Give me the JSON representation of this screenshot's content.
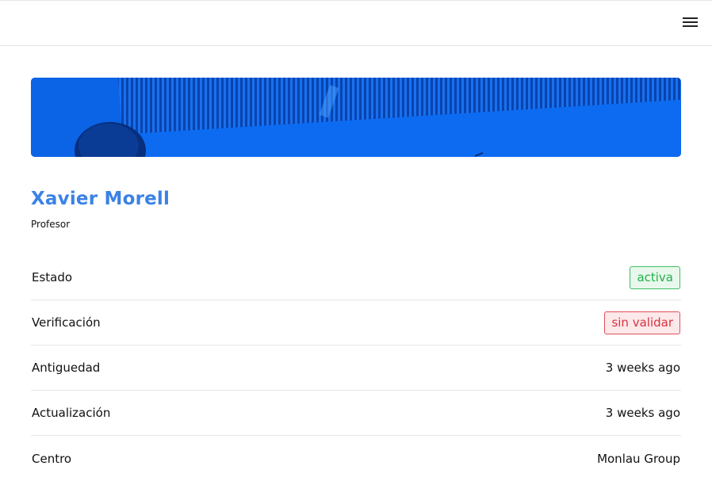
{
  "header": {
    "menu_icon": "hamburger-menu-icon"
  },
  "profile": {
    "name": "Xavier Morell",
    "role": "Profesor"
  },
  "details": [
    {
      "label": "Estado",
      "value": "activa",
      "kind": "badge-success",
      "color": "#22b04b"
    },
    {
      "label": "Verificación",
      "value": "sin validar",
      "kind": "badge-danger",
      "color": "#d6333f"
    },
    {
      "label": "Antiguedad",
      "value": "3 weeks ago",
      "kind": "text"
    },
    {
      "label": "Actualización",
      "value": "3 weeks ago",
      "kind": "text"
    },
    {
      "label": "Centro",
      "value": "Monlau Group",
      "kind": "text"
    }
  ],
  "colors": {
    "accent": "#3b82e6",
    "banner": "#0b63e6"
  }
}
